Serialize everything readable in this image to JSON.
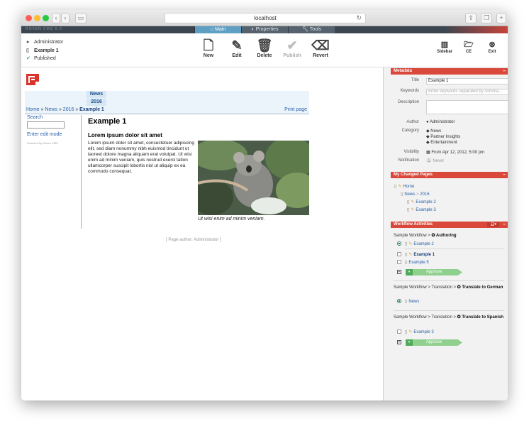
{
  "browser": {
    "url": "localhost",
    "nav_back": "‹",
    "nav_forward": "›"
  },
  "cms": {
    "brand": "ROXEN CMS 6.0",
    "tabs": [
      {
        "label": "Main",
        "active": true
      },
      {
        "label": "Properties",
        "active": false
      },
      {
        "label": "Tools",
        "active": false
      }
    ]
  },
  "toolbar": {
    "user": "Administrator",
    "page": "Example 1",
    "state": "Published",
    "buttons": [
      {
        "label": "New",
        "icon": "document-icon",
        "glyph": "🗋",
        "enabled": true
      },
      {
        "label": "Edit",
        "icon": "pencil-icon",
        "glyph": "✎",
        "enabled": true
      },
      {
        "label": "Delete",
        "icon": "trash-icon",
        "glyph": "🗑",
        "enabled": true
      },
      {
        "label": "Publish",
        "icon": "check-circle-icon",
        "glyph": "✔",
        "enabled": false
      },
      {
        "label": "Revert",
        "icon": "eraser-icon",
        "glyph": "⌫",
        "enabled": true
      }
    ],
    "right_buttons": [
      {
        "label": "Sidebar",
        "icon": "sidebar-icon",
        "glyph": "▥"
      },
      {
        "label": "CE",
        "icon": "folder-icon",
        "glyph": "🗁"
      },
      {
        "label": "Exit",
        "icon": "exit-icon",
        "glyph": "⊗"
      }
    ]
  },
  "site": {
    "nav_labels": [
      "News",
      "2016"
    ],
    "breadcrumb": [
      "Home",
      "News",
      "2016"
    ],
    "breadcrumb_current": "Example 1",
    "print_label": "Print page",
    "search_label": "Search",
    "edit_mode_label": "Enter edit mode",
    "powered_by": "Powered by Roxen CMS",
    "title": "Example 1",
    "subtitle": "Lorem ipsum dolor sit amet",
    "body": "Lorem ipsum dolor sit amet, consectetuer adipiscing elit, sed diam nonummy nibh euismod tincidunt ut laoreet dolore magna aliquam erat volutpat. Ut wisi enim ad minim veniam, quis nostrud exerci tation ullamcorper suscipit lobortis nisl ut aliquip ex ea commodo consequat.",
    "caption": "Ut wisi enim ad minim veniam.",
    "author": "[ Page author: Administrator ]"
  },
  "metadata": {
    "header": "Metadata",
    "title_label": "Title",
    "title_value": "Example 1",
    "keywords_label": "Keywords",
    "keywords_placeholder": "Enter keywords separated by comma...",
    "description_label": "Description",
    "author_label": "Author",
    "author_value": "Administrator",
    "category_label": "Category",
    "categories": [
      "News",
      "Partner Insights",
      "Entertainment"
    ],
    "visibility_label": "Visibility",
    "visibility_value": "From Apr 12, 2012, 5:00 pm",
    "notification_label": "Notification",
    "notification_value": "Never"
  },
  "changed_pages": {
    "header": "My Changed Pages",
    "home": "Home",
    "news": "News",
    "sep": ">",
    "year": "2016",
    "pages": [
      "Example 2",
      "Example 3"
    ]
  },
  "workflow": {
    "header": "Workflow Activities",
    "groups": [
      {
        "path": "Sample Workflow",
        "sep": ">",
        "step": "Authoring",
        "items": [
          "Example 2",
          "Example 1",
          "Example 5"
        ],
        "approve": "Approve"
      },
      {
        "path": "Sample Workflow",
        "sep": ">",
        "sub": "Translation",
        "step": "Translate to German",
        "items": [
          "News"
        ]
      },
      {
        "path": "Sample Workflow",
        "sep": ">",
        "sub": "Translation",
        "step": "Translate to Spanish",
        "items": [
          "Example 3"
        ],
        "approve": "Approve"
      }
    ]
  }
}
